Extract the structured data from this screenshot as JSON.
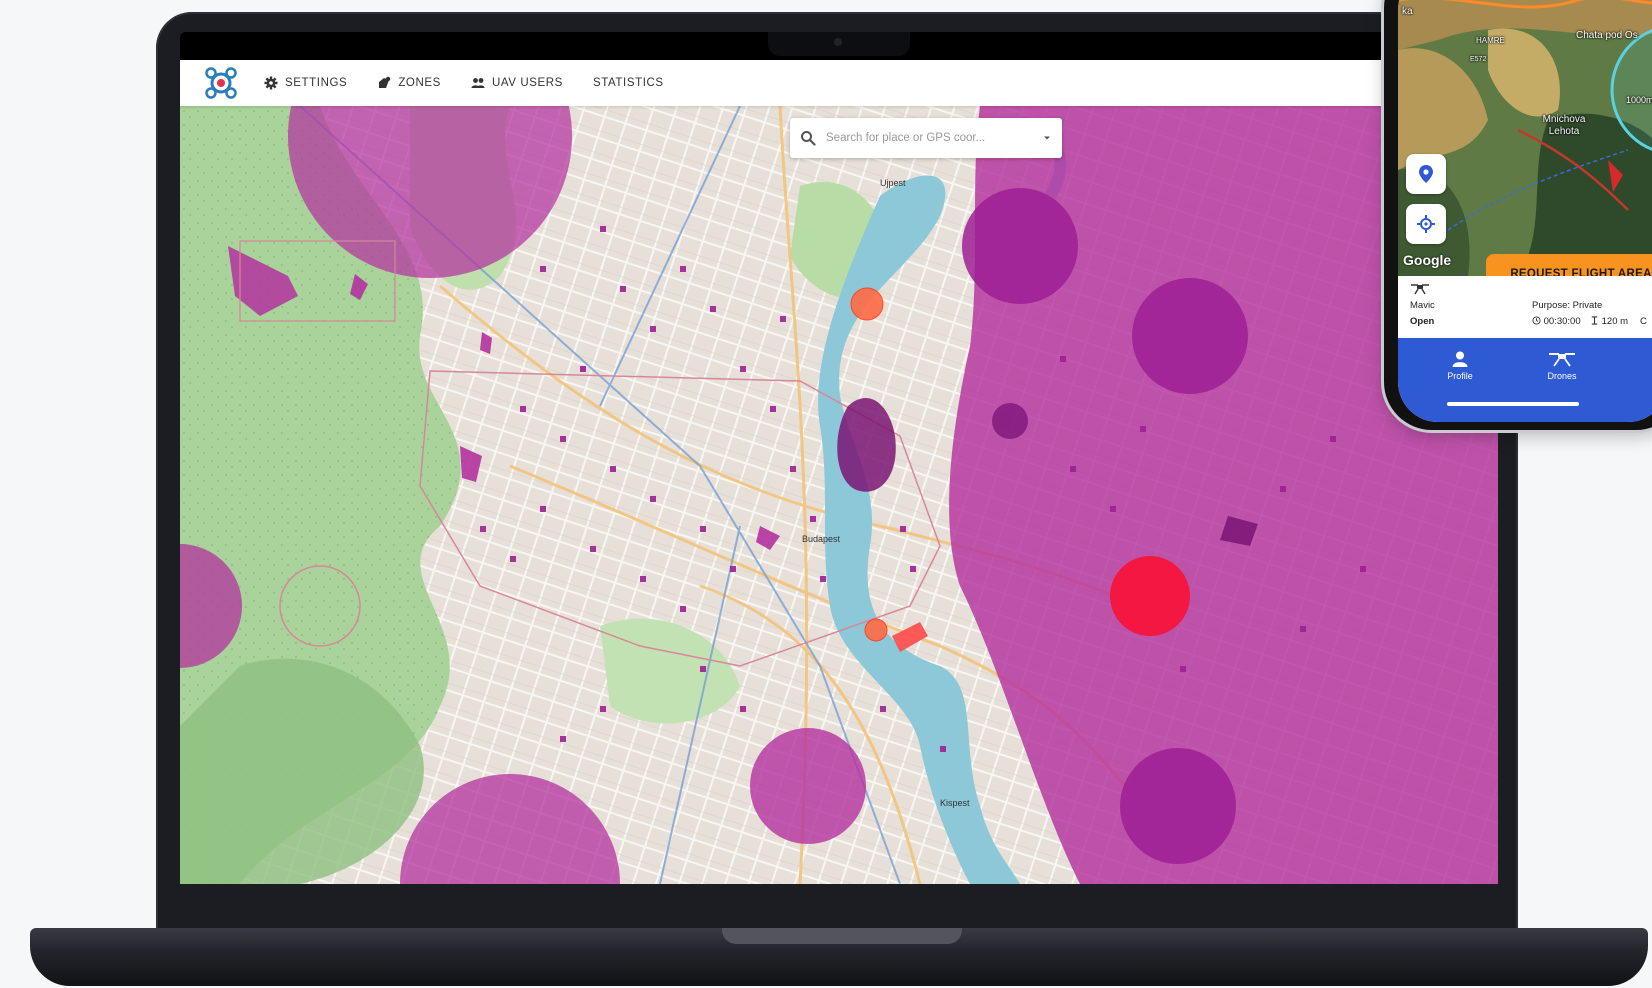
{
  "web_app": {
    "nav": [
      {
        "label": "SETTINGS",
        "icon": "gear-icon"
      },
      {
        "label": "ZONES",
        "icon": "zones-icon"
      },
      {
        "label": "UAV USERS",
        "icon": "users-icon"
      },
      {
        "label": "STATISTICS",
        "icon": ""
      }
    ],
    "search": {
      "placeholder": "Search for place or GPS coor..."
    },
    "map_labels": [
      "Budapest",
      "Ujpest",
      "Kispest"
    ]
  },
  "phone_app": {
    "map_labels": [
      "ka",
      "HAMRE",
      "Chata pod Os",
      "Mnichova Lehota",
      "1000m",
      "E572"
    ],
    "map_attribution": "Google",
    "request_button": "REQUEST FLIGHT AREA",
    "drone": {
      "model": "Mavic",
      "category": "Open"
    },
    "flight": {
      "purpose": "Purpose: Private",
      "duration": "00:30:00",
      "altitude": "120 m",
      "extra": "C"
    },
    "tabs": [
      {
        "label": "Profile"
      },
      {
        "label": "Drones"
      }
    ]
  },
  "colors": {
    "zone_magenta": "#b4329f",
    "zone_red": "#f5143c",
    "zone_orange": "#ff6a45",
    "phone_nav": "#2e5ad4",
    "request_orange": "#f7931e",
    "river": "#8cc8d8"
  }
}
